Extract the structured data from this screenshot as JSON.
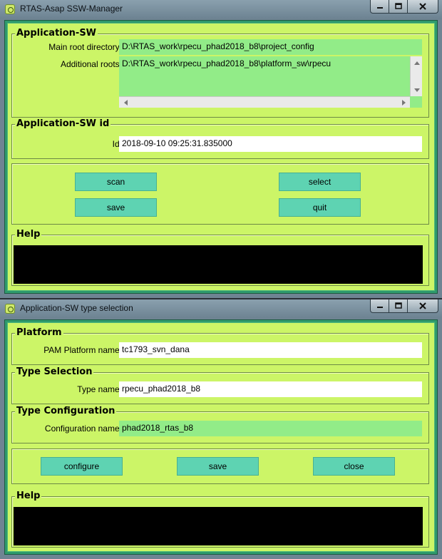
{
  "manager": {
    "title": "RTAS-Asap SSW-Manager",
    "appsw": {
      "legend": "Application-SW",
      "main_root_label": "Main root directory:",
      "main_root_value": "D:\\RTAS_work\\rpecu_phad2018_b8\\project_config",
      "additional_roots_label": "Additional roots:",
      "additional_roots_value": "D:\\RTAS_work\\rpecu_phad2018_b8\\platform_sw\\rpecu"
    },
    "appsw_id": {
      "legend": "Application-SW id",
      "id_label": "Id:",
      "id_value": "2018-09-10 09:25:31.835000"
    },
    "buttons": {
      "scan": "scan",
      "select": "select",
      "save": "save",
      "quit": "quit"
    },
    "help": {
      "legend": "Help"
    }
  },
  "type_selection": {
    "title": "Application-SW type selection",
    "platform": {
      "legend": "Platform",
      "label": "PAM Platform name:",
      "value": "tc1793_svn_dana"
    },
    "type": {
      "legend": "Type Selection",
      "label": "Type name:",
      "value": "rpecu_phad2018_b8"
    },
    "config": {
      "legend": "Type Configuration",
      "label": "Configuration name:",
      "value": "phad2018_rtas_b8"
    },
    "buttons": {
      "configure": "configure",
      "save": "save",
      "close": "close"
    },
    "help": {
      "legend": "Help"
    }
  },
  "colors": {
    "panel_bg": "#ccf567",
    "frame_green": "#2f9a6d",
    "field_green": "#92ec88",
    "button_teal": "#5ed3b2",
    "help_black": "#000000"
  },
  "icons": {
    "app": "app-icon",
    "minimize": "minimize-icon",
    "maximize": "maximize-icon",
    "close": "close-icon"
  }
}
